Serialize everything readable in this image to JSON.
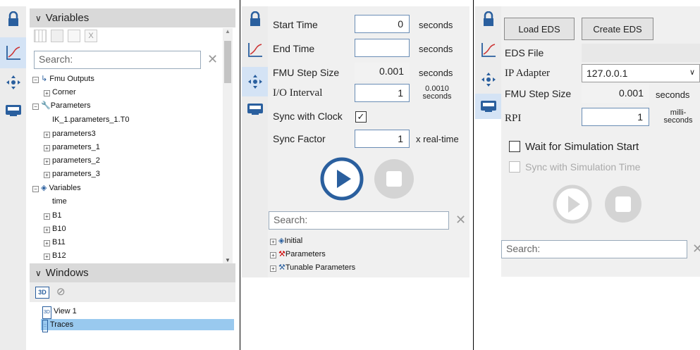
{
  "panel1": {
    "variables_header": "Variables",
    "search_placeholder": "Search:",
    "tree": [
      {
        "label": "Fmu Outputs",
        "icon": "fmu-outputs-icon",
        "toggle": "−"
      },
      {
        "label": "Corner",
        "toggle": "+"
      },
      {
        "label": "Parameters",
        "icon": "wrench-icon",
        "toggle": "−"
      },
      {
        "label": "IK_1.parameters_1.T0"
      },
      {
        "label": "parameters3",
        "toggle": "+"
      },
      {
        "label": "parameters_1",
        "toggle": "+"
      },
      {
        "label": "parameters_2",
        "toggle": "+"
      },
      {
        "label": "parameters_3",
        "toggle": "+"
      },
      {
        "label": "Variables",
        "icon": "diamond-icon",
        "toggle": "−"
      },
      {
        "label": "time"
      },
      {
        "label": "B1",
        "toggle": "+"
      },
      {
        "label": "B10",
        "toggle": "+"
      },
      {
        "label": "B11",
        "toggle": "+"
      },
      {
        "label": "B12",
        "toggle": "+"
      }
    ],
    "windows_header": "Windows",
    "btn_3d": "3D",
    "windows_tree": [
      "View 1",
      "Traces"
    ]
  },
  "panel2": {
    "start_time_label": "Start Time",
    "start_time_value": "0",
    "start_time_unit": "seconds",
    "end_time_label": "End Time",
    "end_time_value": "",
    "end_time_unit": "seconds",
    "step_label": "FMU Step Size",
    "step_value": "0.001",
    "step_unit": "seconds",
    "io_label": "I/O Interval",
    "io_value": "1",
    "io_unit_top": "0.0010",
    "io_unit_bottom": "seconds",
    "sync_label": "Sync with Clock",
    "sync_checked": "✓",
    "factor_label": "Sync Factor",
    "factor_value": "1",
    "factor_unit": "x real-time",
    "search_placeholder": "Search:",
    "tree": [
      {
        "label": "Initial",
        "icon": "diamond-icon"
      },
      {
        "label": "Parameters",
        "icon": "wrench-red-icon"
      },
      {
        "label": "Tunable Parameters",
        "icon": "wrench-blue-icon"
      }
    ]
  },
  "panel3": {
    "load_eds": "Load EDS",
    "create_eds": "Create EDS",
    "eds_file_label": "EDS File",
    "eds_file_value": "",
    "ip_label": "IP Adapter",
    "ip_value": "127.0.0.1",
    "step_label": "FMU Step Size",
    "step_value": "0.001",
    "step_unit": "seconds",
    "rpi_label": "RPI",
    "rpi_value": "1",
    "rpi_unit_top": "milli-",
    "rpi_unit_bottom": "seconds",
    "wait_label": "Wait for Simulation Start",
    "sync_sim_label": "Sync with Simulation Time",
    "search_placeholder": "Search:"
  },
  "colors": {
    "accent": "#2a5f9e",
    "selection": "#99c9ef",
    "header": "#d9d9d9"
  }
}
